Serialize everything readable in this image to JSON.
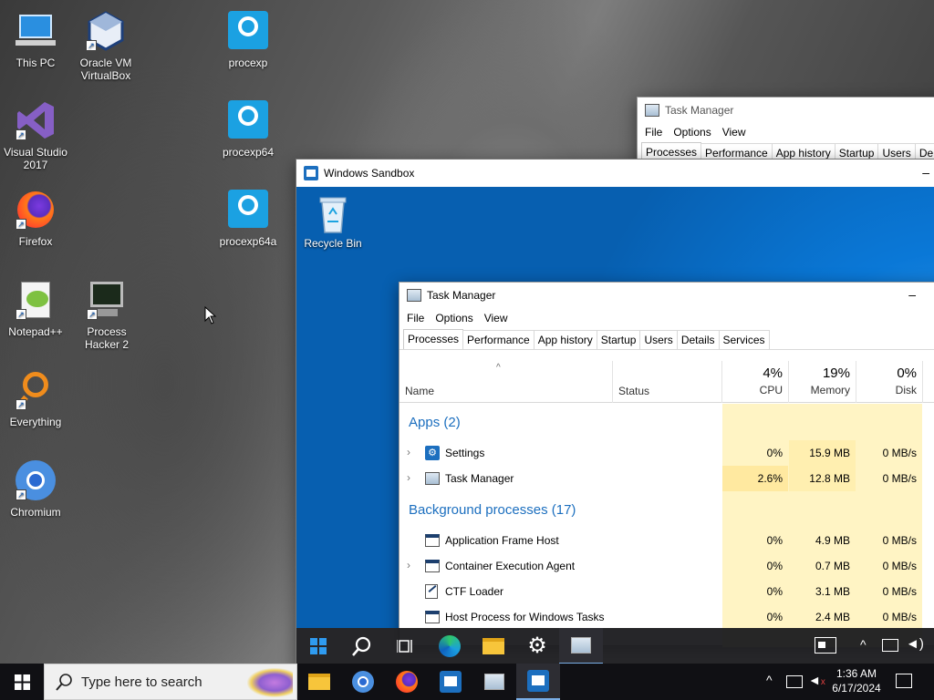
{
  "desktop": {
    "icons": [
      {
        "label": "This PC"
      },
      {
        "label": "Oracle VM VirtualBox"
      },
      {
        "label": "procexp"
      },
      {
        "label": "Visual Studio 2017"
      },
      {
        "label": "procexp64"
      },
      {
        "label": "Firefox"
      },
      {
        "label": "procexp64a"
      },
      {
        "label": "Notepad++"
      },
      {
        "label": "Process Hacker 2"
      },
      {
        "label": "Everything"
      },
      {
        "label": "Chromium"
      }
    ]
  },
  "bg_task_manager": {
    "title": "Task Manager",
    "menu": [
      "File",
      "Options",
      "View"
    ],
    "tabs": [
      "Processes",
      "Performance",
      "App history",
      "Startup",
      "Users",
      "De"
    ]
  },
  "sandbox": {
    "title": "Windows Sandbox",
    "recycle_bin": "Recycle Bin",
    "task_manager": {
      "title": "Task Manager",
      "menu": [
        "File",
        "Options",
        "View"
      ],
      "tabs": [
        "Processes",
        "Performance",
        "App history",
        "Startup",
        "Users",
        "Details",
        "Services"
      ],
      "columns": {
        "name": "Name",
        "status": "Status",
        "cpu": {
          "pct": "4%",
          "label": "CPU"
        },
        "memory": {
          "pct": "19%",
          "label": "Memory"
        },
        "disk": {
          "pct": "0%",
          "label": "Disk"
        }
      },
      "apps_header": "Apps (2)",
      "apps": [
        {
          "name": "Settings",
          "cpu": "0%",
          "memory": "15.9 MB",
          "disk": "0 MB/s"
        },
        {
          "name": "Task Manager",
          "cpu": "2.6%",
          "memory": "12.8 MB",
          "disk": "0 MB/s"
        }
      ],
      "bg_header": "Background processes (17)",
      "background": [
        {
          "name": "Application Frame Host",
          "cpu": "0%",
          "memory": "4.9 MB",
          "disk": "0 MB/s"
        },
        {
          "name": "Container Execution Agent",
          "cpu": "0%",
          "memory": "0.7 MB",
          "disk": "0 MB/s"
        },
        {
          "name": "CTF Loader",
          "cpu": "0%",
          "memory": "3.1 MB",
          "disk": "0 MB/s"
        },
        {
          "name": "Host Process for Windows Tasks",
          "cpu": "0%",
          "memory": "2.4 MB",
          "disk": "0 MB/s"
        }
      ]
    }
  },
  "host_taskbar": {
    "search_placeholder": "Type here to search",
    "time": "1:36 AM",
    "date": "6/17/2024"
  },
  "colors": {
    "sandbox_desktop": "#0a78d7",
    "accent": "#1c6fbf",
    "heat_light": "#fff4c4",
    "heat": "#ffefb0"
  }
}
